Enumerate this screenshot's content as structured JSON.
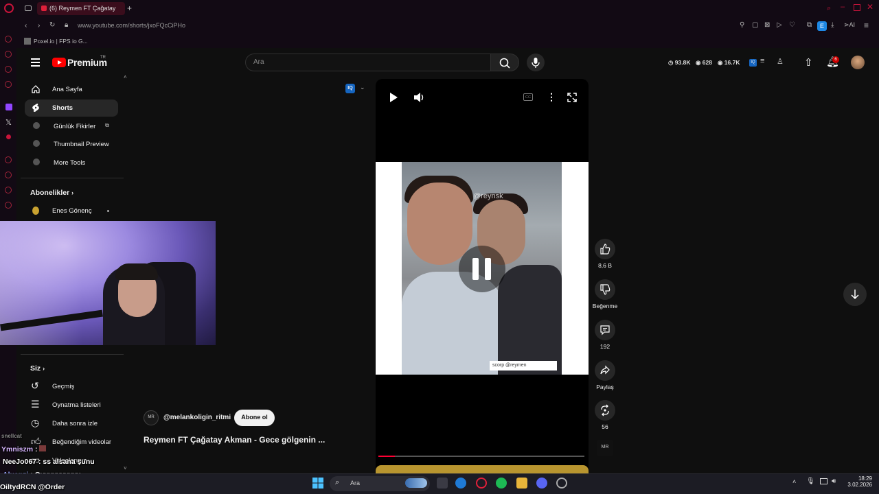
{
  "browser": {
    "tab_title": "(6) Reymen FT Çağatay",
    "url": "www.youtube.com/shorts/jxoFQcCiPHo",
    "bookmark": "Poxel.io | FPS io G...",
    "extension_badge": "E"
  },
  "youtube": {
    "logo_text": "Premium",
    "logo_region": "TR",
    "search_placeholder": "Ara",
    "stats": {
      "views": "93.8K",
      "watching": "628",
      "likes": "16.7K"
    },
    "notification_count": "6",
    "filter_badge": "IQ"
  },
  "sidebar": {
    "items": [
      {
        "label": "Ana Sayfa",
        "icon": "home-icon"
      },
      {
        "label": "Shorts",
        "icon": "shorts-icon"
      },
      {
        "label": "Günlük Fikirler",
        "icon": "channel-icon"
      },
      {
        "label": "Thumbnail Preview",
        "icon": "channel-icon"
      },
      {
        "label": "More Tools",
        "icon": "channel-icon"
      }
    ],
    "subscriptions_title": "Abonelikler",
    "subscriptions": [
      {
        "label": "Enes Gönenç"
      }
    ],
    "you_title": "Siz",
    "you_items": [
      {
        "label": "Geçmiş",
        "icon": "history-icon"
      },
      {
        "label": "Oynatma listeleri",
        "icon": "playlist-icon"
      },
      {
        "label": "Daha sonra izle",
        "icon": "watch-later-icon"
      },
      {
        "label": "Beğendiğim videolar",
        "icon": "like-icon"
      },
      {
        "label": "Videolarınız",
        "icon": "video-icon"
      }
    ]
  },
  "short": {
    "channel": "@melankoligin_ritmi",
    "subscribe": "Abone ol",
    "title": "Reymen FT Çağatay Akman - Gece gölgenin ...",
    "watermark": "@reynsk",
    "scorp_label": "scorp @reymen",
    "progress": 0.08,
    "actions": {
      "likes": "8,6 B",
      "dislike": "Beğenme",
      "comments": "192",
      "share": "Paylaş",
      "remix": "56"
    }
  },
  "chat": [
    {
      "user": "snellcat",
      "text": ""
    },
    {
      "user": "Ymniszm",
      "text": ":"
    },
    {
      "user": "NeeJo067",
      "text": ": ss alsana şunu"
    },
    {
      "user": "Aluanzi",
      "text": ": Oyyyyyyyyyy"
    },
    {
      "user": "OiltydRCN",
      "text": "@Order"
    }
  ],
  "taskbar": {
    "search": "Ara",
    "time": "18:29",
    "date": "3.02.2026"
  },
  "colors": {
    "accent": "#ff0000",
    "background": "#0f0f0f",
    "browser_accent": "#e0203a"
  }
}
